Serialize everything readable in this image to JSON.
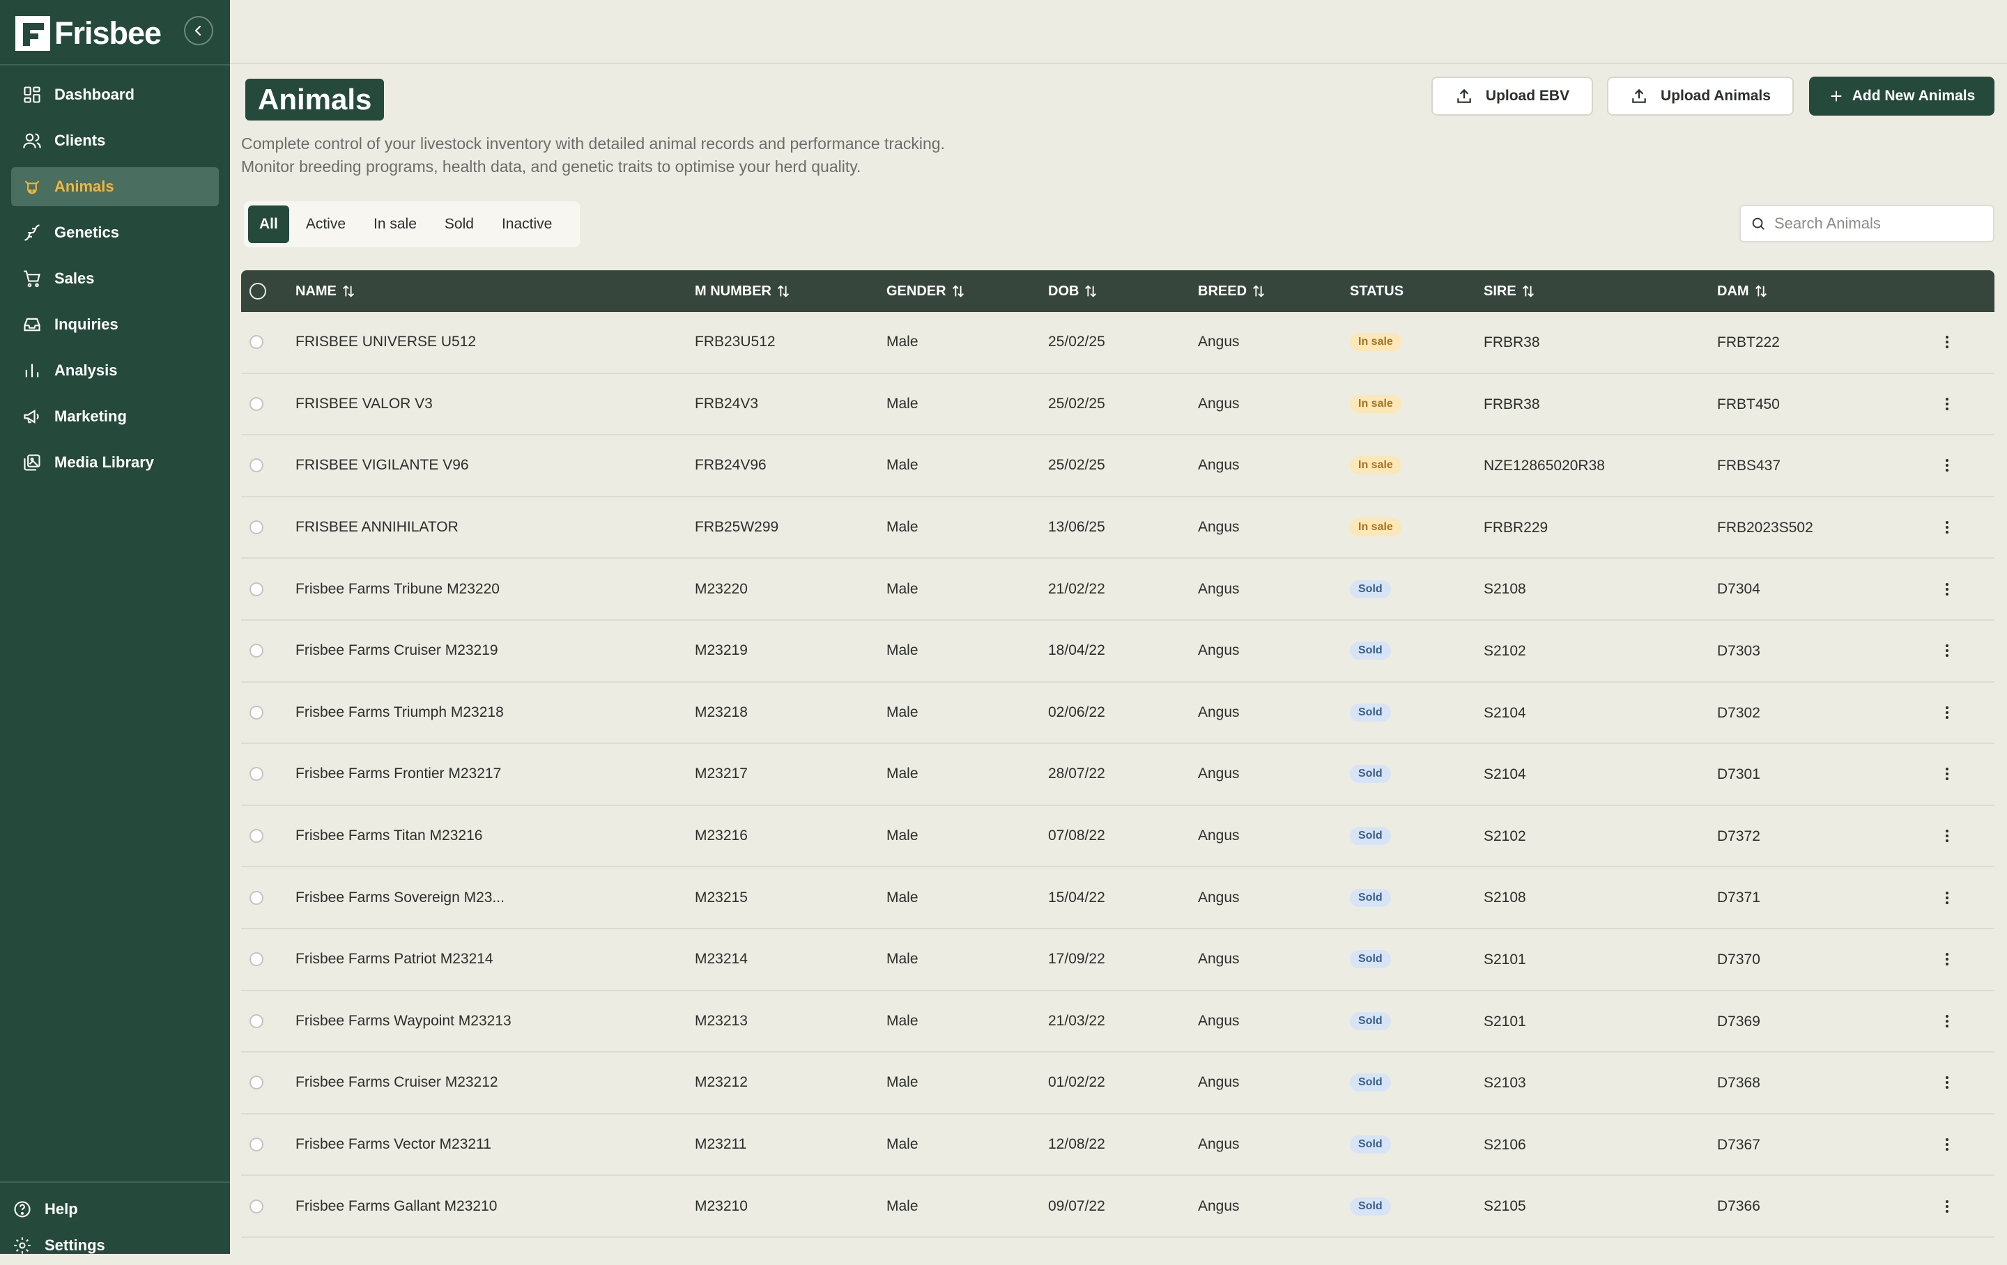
{
  "brand": {
    "name": "Frisbee"
  },
  "nav": {
    "items": [
      {
        "label": "Dashboard",
        "icon": "dashboard-icon"
      },
      {
        "label": "Clients",
        "icon": "users-icon"
      },
      {
        "label": "Animals",
        "icon": "cow-icon",
        "active": true
      },
      {
        "label": "Genetics",
        "icon": "dna-icon"
      },
      {
        "label": "Sales",
        "icon": "cart-icon"
      },
      {
        "label": "Inquiries",
        "icon": "inbox-icon"
      },
      {
        "label": "Analysis",
        "icon": "bar-chart-icon"
      },
      {
        "label": "Marketing",
        "icon": "megaphone-icon"
      },
      {
        "label": "Media Library",
        "icon": "media-icon"
      }
    ],
    "bottom": [
      {
        "label": "Help",
        "icon": "help-icon"
      },
      {
        "label": "Settings",
        "icon": "gear-icon"
      }
    ]
  },
  "page": {
    "title": "Animals",
    "description_line1": "Complete control of your livestock inventory with detailed animal records and performance tracking.",
    "description_line2": "Monitor breeding programs, health data, and genetic traits to optimise your herd quality."
  },
  "actions": {
    "upload_ebv": "Upload EBV",
    "upload_animals": "Upload Animals",
    "add_new": "Add New Animals"
  },
  "tabs": [
    "All",
    "Active",
    "In sale",
    "Sold",
    "Inactive"
  ],
  "active_tab": "All",
  "search": {
    "placeholder": "Search Animals"
  },
  "colors": {
    "brand_green": "#254a3c",
    "active_nav_text": "#f4b63a",
    "in_sale_badge": "#fbe7b8",
    "sold_badge": "#d7e4f5"
  },
  "table": {
    "headers": {
      "name": "NAME",
      "m_number": "M NUMBER",
      "gender": "GENDER",
      "dob": "DOB",
      "breed": "BREED",
      "status": "STATUS",
      "sire": "SIRE",
      "dam": "DAM"
    },
    "rows": [
      {
        "name": "FRISBEE UNIVERSE U512",
        "m_number": "FRB23U512",
        "gender": "Male",
        "dob": "25/02/25",
        "breed": "Angus",
        "status": "In sale",
        "sire": "FRBR38",
        "dam": "FRBT222"
      },
      {
        "name": "FRISBEE VALOR V3",
        "m_number": "FRB24V3",
        "gender": "Male",
        "dob": "25/02/25",
        "breed": "Angus",
        "status": "In sale",
        "sire": "FRBR38",
        "dam": "FRBT450"
      },
      {
        "name": "FRISBEE VIGILANTE V96",
        "m_number": "FRB24V96",
        "gender": "Male",
        "dob": "25/02/25",
        "breed": "Angus",
        "status": "In sale",
        "sire": "NZE12865020R38",
        "dam": "FRBS437"
      },
      {
        "name": "FRISBEE ANNIHILATOR",
        "m_number": "FRB25W299",
        "gender": "Male",
        "dob": "13/06/25",
        "breed": "Angus",
        "status": "In sale",
        "sire": "FRBR229",
        "dam": "FRB2023S502"
      },
      {
        "name": "Frisbee Farms Tribune M23220",
        "m_number": "M23220",
        "gender": "Male",
        "dob": "21/02/22",
        "breed": "Angus",
        "status": "Sold",
        "sire": "S2108",
        "dam": "D7304"
      },
      {
        "name": "Frisbee Farms Cruiser M23219",
        "m_number": "M23219",
        "gender": "Male",
        "dob": "18/04/22",
        "breed": "Angus",
        "status": "Sold",
        "sire": "S2102",
        "dam": "D7303"
      },
      {
        "name": "Frisbee Farms Triumph M23218",
        "m_number": "M23218",
        "gender": "Male",
        "dob": "02/06/22",
        "breed": "Angus",
        "status": "Sold",
        "sire": "S2104",
        "dam": "D7302"
      },
      {
        "name": "Frisbee Farms Frontier M23217",
        "m_number": "M23217",
        "gender": "Male",
        "dob": "28/07/22",
        "breed": "Angus",
        "status": "Sold",
        "sire": "S2104",
        "dam": "D7301"
      },
      {
        "name": "Frisbee Farms Titan M23216",
        "m_number": "M23216",
        "gender": "Male",
        "dob": "07/08/22",
        "breed": "Angus",
        "status": "Sold",
        "sire": "S2102",
        "dam": "D7372"
      },
      {
        "name": "Frisbee Farms Sovereign M23...",
        "m_number": "M23215",
        "gender": "Male",
        "dob": "15/04/22",
        "breed": "Angus",
        "status": "Sold",
        "sire": "S2108",
        "dam": "D7371"
      },
      {
        "name": "Frisbee Farms Patriot M23214",
        "m_number": "M23214",
        "gender": "Male",
        "dob": "17/09/22",
        "breed": "Angus",
        "status": "Sold",
        "sire": "S2101",
        "dam": "D7370"
      },
      {
        "name": "Frisbee Farms Waypoint M23213",
        "m_number": "M23213",
        "gender": "Male",
        "dob": "21/03/22",
        "breed": "Angus",
        "status": "Sold",
        "sire": "S2101",
        "dam": "D7369"
      },
      {
        "name": "Frisbee Farms Cruiser M23212",
        "m_number": "M23212",
        "gender": "Male",
        "dob": "01/02/22",
        "breed": "Angus",
        "status": "Sold",
        "sire": "S2103",
        "dam": "D7368"
      },
      {
        "name": "Frisbee Farms Vector M23211",
        "m_number": "M23211",
        "gender": "Male",
        "dob": "12/08/22",
        "breed": "Angus",
        "status": "Sold",
        "sire": "S2106",
        "dam": "D7367"
      },
      {
        "name": "Frisbee Farms Gallant M23210",
        "m_number": "M23210",
        "gender": "Male",
        "dob": "09/07/22",
        "breed": "Angus",
        "status": "Sold",
        "sire": "S2105",
        "dam": "D7366"
      }
    ]
  }
}
